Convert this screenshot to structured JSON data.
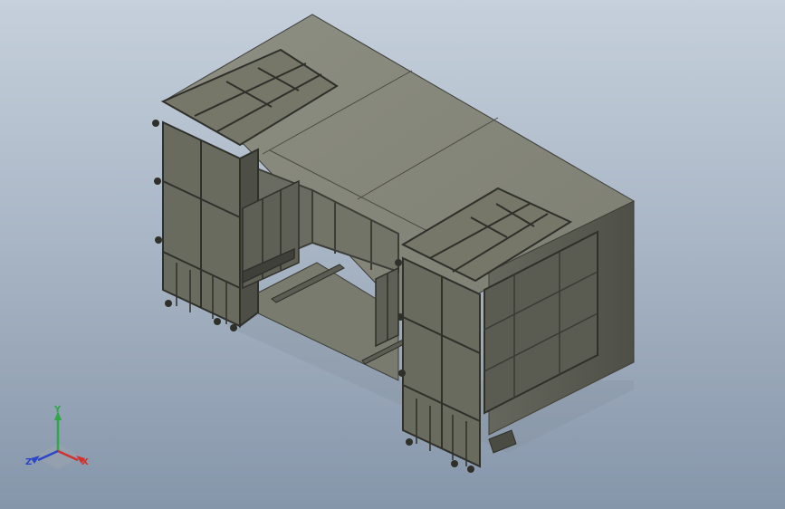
{
  "viewport": {
    "background_top": "#c6d0dc",
    "background_bottom": "#8696aa"
  },
  "model": {
    "body_color": "#6f7063",
    "frame_color": "#3c3d36",
    "light_face": "#8a8b7e",
    "dark_face": "#55564c"
  },
  "triad": {
    "x_label": "X",
    "y_label": "Y",
    "z_label": "Z",
    "x_color": "#d0322e",
    "y_color": "#2fa84a",
    "z_color": "#2c46c9"
  }
}
